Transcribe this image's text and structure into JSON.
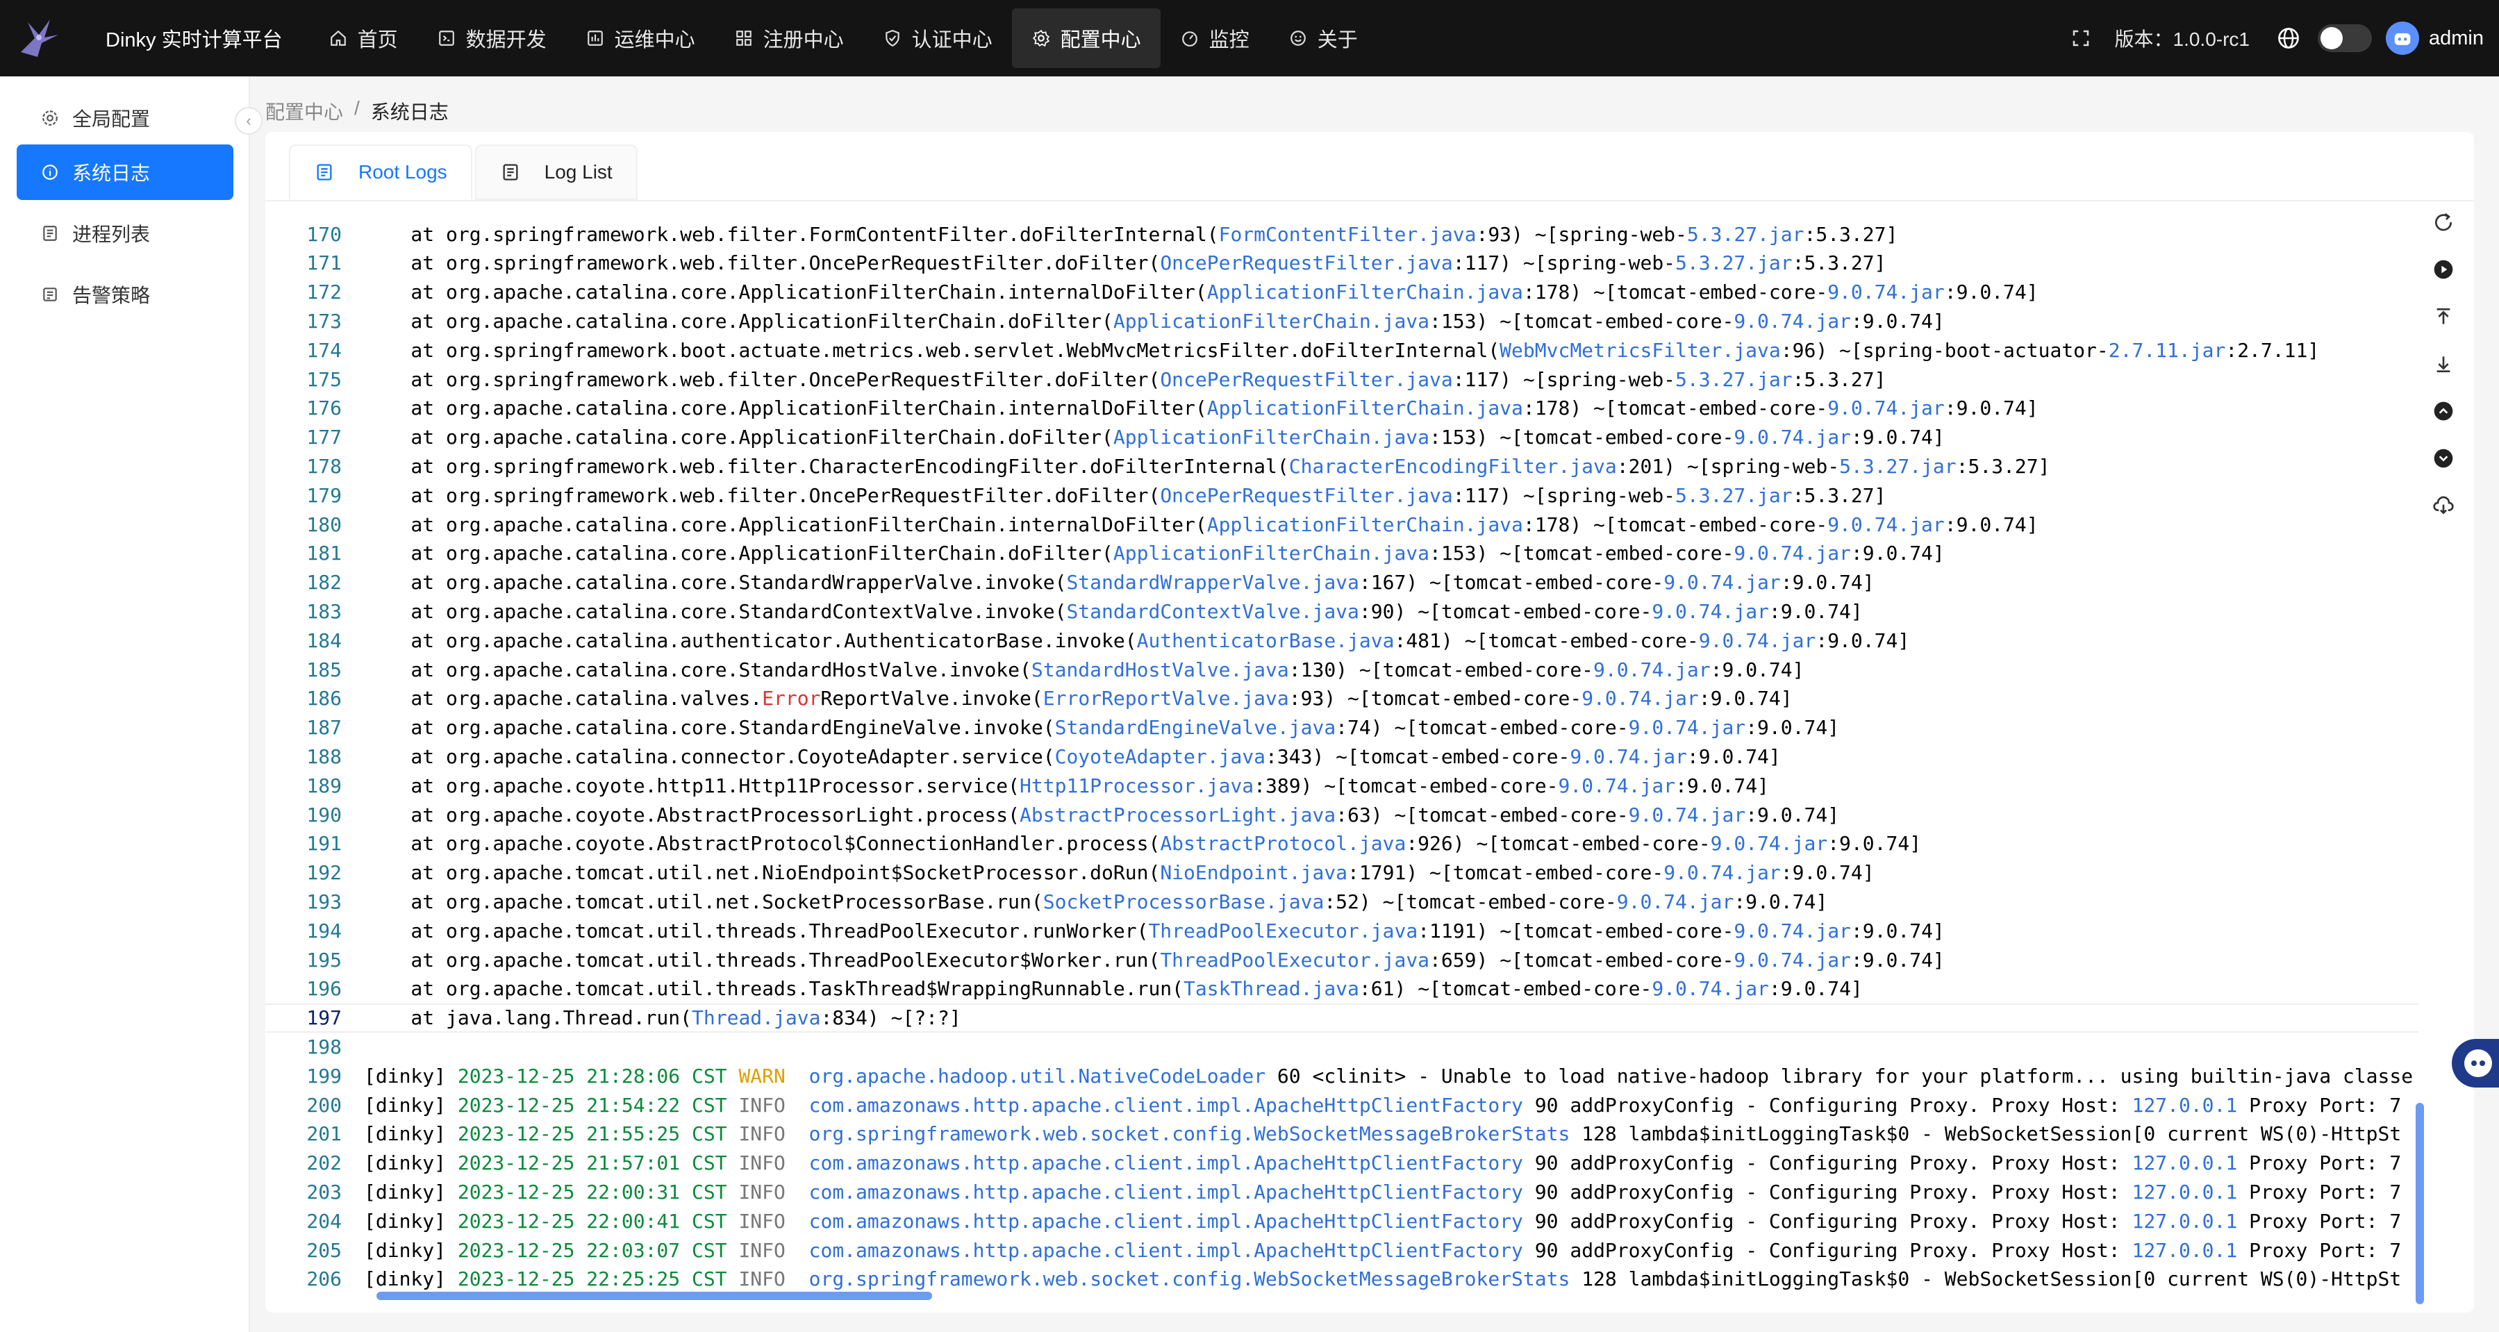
{
  "header": {
    "app_title": "Dinky 实时计算平台",
    "nav": [
      {
        "label": "首页",
        "icon": "home-icon"
      },
      {
        "label": "数据开发",
        "icon": "code-icon"
      },
      {
        "label": "运维中心",
        "icon": "ops-icon"
      },
      {
        "label": "注册中心",
        "icon": "registry-icon"
      },
      {
        "label": "认证中心",
        "icon": "shield-icon"
      },
      {
        "label": "配置中心",
        "icon": "gear-icon",
        "active": true
      },
      {
        "label": "监控",
        "icon": "dashboard-icon"
      },
      {
        "label": "关于",
        "icon": "smile-icon"
      }
    ],
    "version": "版本：1.0.0-rc1",
    "username": "admin"
  },
  "sidebar": {
    "items": [
      {
        "label": "全局配置",
        "icon": "gear-icon"
      },
      {
        "label": "系统日志",
        "icon": "info-icon",
        "active": true
      },
      {
        "label": "进程列表",
        "icon": "process-icon"
      },
      {
        "label": "告警策略",
        "icon": "alert-icon"
      }
    ]
  },
  "breadcrumb": {
    "parent": "配置中心",
    "separator": "/",
    "current": "系统日志"
  },
  "tabs": [
    {
      "label": "Root Logs",
      "active": true
    },
    {
      "label": "Log List"
    }
  ],
  "log": {
    "current_line": 197,
    "lines": [
      {
        "n": "170",
        "t": "stack",
        "pre": "    at org.springframework.web.filter.FormContentFilter.doFilterInternal(",
        "file": "FormContentFilter.java",
        "num": ":93) ~[spring-web-",
        "ver": "5.3.27.jar",
        "tail": ":5.3.27]"
      },
      {
        "n": "171",
        "t": "stack",
        "pre": "    at org.springframework.web.filter.OncePerRequestFilter.doFilter(",
        "file": "OncePerRequestFilter.java",
        "num": ":117) ~[spring-web-",
        "ver": "5.3.27.jar",
        "tail": ":5.3.27]"
      },
      {
        "n": "172",
        "t": "stack",
        "pre": "    at org.apache.catalina.core.ApplicationFilterChain.internalDoFilter(",
        "file": "ApplicationFilterChain.java",
        "num": ":178) ~[tomcat-embed-core-",
        "ver": "9.0.74.jar",
        "tail": ":9.0.74]"
      },
      {
        "n": "173",
        "t": "stack",
        "pre": "    at org.apache.catalina.core.ApplicationFilterChain.doFilter(",
        "file": "ApplicationFilterChain.java",
        "num": ":153) ~[tomcat-embed-core-",
        "ver": "9.0.74.jar",
        "tail": ":9.0.74]"
      },
      {
        "n": "174",
        "t": "stack",
        "pre": "    at org.springframework.boot.actuate.metrics.web.servlet.WebMvcMetricsFilter.doFilterInternal(",
        "file": "WebMvcMetricsFilter.java",
        "num": ":96) ~[spring-boot-actuator-",
        "ver": "2.7.11.jar",
        "tail": ":2.7.11]"
      },
      {
        "n": "175",
        "t": "stack",
        "pre": "    at org.springframework.web.filter.OncePerRequestFilter.doFilter(",
        "file": "OncePerRequestFilter.java",
        "num": ":117) ~[spring-web-",
        "ver": "5.3.27.jar",
        "tail": ":5.3.27]"
      },
      {
        "n": "176",
        "t": "stack",
        "pre": "    at org.apache.catalina.core.ApplicationFilterChain.internalDoFilter(",
        "file": "ApplicationFilterChain.java",
        "num": ":178) ~[tomcat-embed-core-",
        "ver": "9.0.74.jar",
        "tail": ":9.0.74]"
      },
      {
        "n": "177",
        "t": "stack",
        "pre": "    at org.apache.catalina.core.ApplicationFilterChain.doFilter(",
        "file": "ApplicationFilterChain.java",
        "num": ":153) ~[tomcat-embed-core-",
        "ver": "9.0.74.jar",
        "tail": ":9.0.74]"
      },
      {
        "n": "178",
        "t": "stack",
        "pre": "    at org.springframework.web.filter.CharacterEncodingFilter.doFilterInternal(",
        "file": "CharacterEncodingFilter.java",
        "num": ":201) ~[spring-web-",
        "ver": "5.3.27.jar",
        "tail": ":5.3.27]"
      },
      {
        "n": "179",
        "t": "stack",
        "pre": "    at org.springframework.web.filter.OncePerRequestFilter.doFilter(",
        "file": "OncePerRequestFilter.java",
        "num": ":117) ~[spring-web-",
        "ver": "5.3.27.jar",
        "tail": ":5.3.27]"
      },
      {
        "n": "180",
        "t": "stack",
        "pre": "    at org.apache.catalina.core.ApplicationFilterChain.internalDoFilter(",
        "file": "ApplicationFilterChain.java",
        "num": ":178) ~[tomcat-embed-core-",
        "ver": "9.0.74.jar",
        "tail": ":9.0.74]"
      },
      {
        "n": "181",
        "t": "stack",
        "pre": "    at org.apache.catalina.core.ApplicationFilterChain.doFilter(",
        "file": "ApplicationFilterChain.java",
        "num": ":153) ~[tomcat-embed-core-",
        "ver": "9.0.74.jar",
        "tail": ":9.0.74]"
      },
      {
        "n": "182",
        "t": "stack",
        "pre": "    at org.apache.catalina.core.StandardWrapperValve.invoke(",
        "file": "StandardWrapperValve.java",
        "num": ":167) ~[tomcat-embed-core-",
        "ver": "9.0.74.jar",
        "tail": ":9.0.74]"
      },
      {
        "n": "183",
        "t": "stack",
        "pre": "    at org.apache.catalina.core.StandardContextValve.invoke(",
        "file": "StandardContextValve.java",
        "num": ":90) ~[tomcat-embed-core-",
        "ver": "9.0.74.jar",
        "tail": ":9.0.74]"
      },
      {
        "n": "184",
        "t": "stack",
        "pre": "    at org.apache.catalina.authenticator.AuthenticatorBase.invoke(",
        "file": "AuthenticatorBase.java",
        "num": ":481) ~[tomcat-embed-core-",
        "ver": "9.0.74.jar",
        "tail": ":9.0.74]"
      },
      {
        "n": "185",
        "t": "stack",
        "pre": "    at org.apache.catalina.core.StandardHostValve.invoke(",
        "file": "StandardHostValve.java",
        "num": ":130) ~[tomcat-embed-core-",
        "ver": "9.0.74.jar",
        "tail": ":9.0.74]"
      },
      {
        "n": "186",
        "t": "stack",
        "pre": "    at org.apache.catalina.valves.",
        "err": "Error",
        "pre2": "ReportValve.invoke(",
        "file": "ErrorReportValve.java",
        "num": ":93) ~[tomcat-embed-core-",
        "ver": "9.0.74.jar",
        "tail": ":9.0.74]"
      },
      {
        "n": "187",
        "t": "stack",
        "pre": "    at org.apache.catalina.core.StandardEngineValve.invoke(",
        "file": "StandardEngineValve.java",
        "num": ":74) ~[tomcat-embed-core-",
        "ver": "9.0.74.jar",
        "tail": ":9.0.74]"
      },
      {
        "n": "188",
        "t": "stack",
        "pre": "    at org.apache.catalina.connector.CoyoteAdapter.service(",
        "file": "CoyoteAdapter.java",
        "num": ":343) ~[tomcat-embed-core-",
        "ver": "9.0.74.jar",
        "tail": ":9.0.74]"
      },
      {
        "n": "189",
        "t": "stack",
        "pre": "    at org.apache.coyote.http11.Http11Processor.service(",
        "file": "Http11Processor.java",
        "num": ":389) ~[tomcat-embed-core-",
        "ver": "9.0.74.jar",
        "tail": ":9.0.74]"
      },
      {
        "n": "190",
        "t": "stack",
        "pre": "    at org.apache.coyote.AbstractProcessorLight.process(",
        "file": "AbstractProcessorLight.java",
        "num": ":63) ~[tomcat-embed-core-",
        "ver": "9.0.74.jar",
        "tail": ":9.0.74]"
      },
      {
        "n": "191",
        "t": "stack",
        "pre": "    at org.apache.coyote.AbstractProtocol$ConnectionHandler.process(",
        "file": "AbstractProtocol.java",
        "num": ":926) ~[tomcat-embed-core-",
        "ver": "9.0.74.jar",
        "tail": ":9.0.74]"
      },
      {
        "n": "192",
        "t": "stack",
        "pre": "    at org.apache.tomcat.util.net.NioEndpoint$SocketProcessor.doRun(",
        "file": "NioEndpoint.java",
        "num": ":1791) ~[tomcat-embed-core-",
        "ver": "9.0.74.jar",
        "tail": ":9.0.74]"
      },
      {
        "n": "193",
        "t": "stack",
        "pre": "    at org.apache.tomcat.util.net.SocketProcessorBase.run(",
        "file": "SocketProcessorBase.java",
        "num": ":52) ~[tomcat-embed-core-",
        "ver": "9.0.74.jar",
        "tail": ":9.0.74]"
      },
      {
        "n": "194",
        "t": "stack",
        "pre": "    at org.apache.tomcat.util.threads.ThreadPoolExecutor.runWorker(",
        "file": "ThreadPoolExecutor.java",
        "num": ":1191) ~[tomcat-embed-core-",
        "ver": "9.0.74.jar",
        "tail": ":9.0.74]"
      },
      {
        "n": "195",
        "t": "stack",
        "pre": "    at org.apache.tomcat.util.threads.ThreadPoolExecutor$Worker.run(",
        "file": "ThreadPoolExecutor.java",
        "num": ":659) ~[tomcat-embed-core-",
        "ver": "9.0.74.jar",
        "tail": ":9.0.74]"
      },
      {
        "n": "196",
        "t": "stack",
        "pre": "    at org.apache.tomcat.util.threads.TaskThread$WrappingRunnable.run(",
        "file": "TaskThread.java",
        "num": ":61) ~[tomcat-embed-core-",
        "ver": "9.0.74.jar",
        "tail": ":9.0.74]"
      },
      {
        "n": "197",
        "t": "stack",
        "pre": "    at java.lang.Thread.run(",
        "file": "Thread.java",
        "num": ":834) ~[?:?]",
        "ver": "",
        "tail": ""
      },
      {
        "n": "198",
        "t": "blank"
      },
      {
        "n": "199",
        "t": "log",
        "tag": "[dinky] ",
        "date": "2023-12-25 21:28:06 CST",
        "lvl": "WARN",
        "cls": "org.apache.hadoop.util.NativeCodeLoader",
        "msg": " 60 <clinit> - Unable to load native-hadoop library for your platform... using builtin-java classe"
      },
      {
        "n": "200",
        "t": "log",
        "tag": "[dinky] ",
        "date": "2023-12-25 21:54:22 CST",
        "lvl": "INFO",
        "cls": "com.amazonaws.http.apache.client.impl.ApacheHttpClientFactory",
        "msg": " 90 addProxyConfig - Configuring Proxy. Proxy Host: ",
        "ip": "127.0.0.1",
        "msg2": " Proxy Port: 7"
      },
      {
        "n": "201",
        "t": "log",
        "tag": "[dinky] ",
        "date": "2023-12-25 21:55:25 CST",
        "lvl": "INFO",
        "cls": "org.springframework.web.socket.config.WebSocketMessageBrokerStats",
        "msg": " 128 lambda$initLoggingTask$0 - WebSocketSession[0 current WS(0)-HttpSt"
      },
      {
        "n": "202",
        "t": "log",
        "tag": "[dinky] ",
        "date": "2023-12-25 21:57:01 CST",
        "lvl": "INFO",
        "cls": "com.amazonaws.http.apache.client.impl.ApacheHttpClientFactory",
        "msg": " 90 addProxyConfig - Configuring Proxy. Proxy Host: ",
        "ip": "127.0.0.1",
        "msg2": " Proxy Port: 7"
      },
      {
        "n": "203",
        "t": "log",
        "tag": "[dinky] ",
        "date": "2023-12-25 22:00:31 CST",
        "lvl": "INFO",
        "cls": "com.amazonaws.http.apache.client.impl.ApacheHttpClientFactory",
        "msg": " 90 addProxyConfig - Configuring Proxy. Proxy Host: ",
        "ip": "127.0.0.1",
        "msg2": " Proxy Port: 7"
      },
      {
        "n": "204",
        "t": "log",
        "tag": "[dinky] ",
        "date": "2023-12-25 22:00:41 CST",
        "lvl": "INFO",
        "cls": "com.amazonaws.http.apache.client.impl.ApacheHttpClientFactory",
        "msg": " 90 addProxyConfig - Configuring Proxy. Proxy Host: ",
        "ip": "127.0.0.1",
        "msg2": " Proxy Port: 7"
      },
      {
        "n": "205",
        "t": "log",
        "tag": "[dinky] ",
        "date": "2023-12-25 22:03:07 CST",
        "lvl": "INFO",
        "cls": "com.amazonaws.http.apache.client.impl.ApacheHttpClientFactory",
        "msg": " 90 addProxyConfig - Configuring Proxy. Proxy Host: ",
        "ip": "127.0.0.1",
        "msg2": " Proxy Port: 7"
      },
      {
        "n": "206",
        "t": "log",
        "tag": "[dinky] ",
        "date": "2023-12-25 22:25:25 CST",
        "lvl": "INFO",
        "cls": "org.springframework.web.socket.config.WebSocketMessageBrokerStats",
        "msg": " 128 lambda$initLoggingTask$0 - WebSocketSession[0 current WS(0)-HttpSt"
      }
    ]
  },
  "toolbar": [
    "refresh-icon",
    "play-icon",
    "scroll-top-icon",
    "scroll-bottom-icon",
    "arrow-up-icon",
    "arrow-down-icon",
    "download-icon"
  ],
  "colors": {
    "accent": "#1677ff",
    "topbar": "#141414",
    "link": "#2f6fd8",
    "date": "#0b8a3a",
    "warn": "#e0a000"
  }
}
